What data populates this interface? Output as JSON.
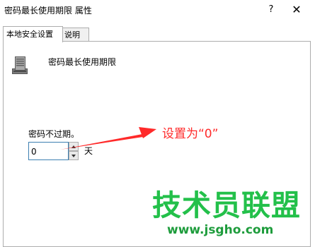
{
  "window": {
    "title": "密码最长使用期限 属性",
    "help_label": "?",
    "close_label": "✕"
  },
  "tabs": [
    {
      "label": "本地安全设置",
      "active": true
    },
    {
      "label": "说明",
      "active": false
    }
  ],
  "policy": {
    "icon": "server-icon",
    "name": "密码最长使用期限",
    "never_expire_label": "密码不过期。",
    "value": "0",
    "unit": "天"
  },
  "annotation": {
    "text": "设置为“0”",
    "color": "#ff2a2a"
  },
  "watermark": {
    "site_name": "技术员联盟",
    "url": "www.jsgho.com",
    "color": "#23c04a"
  }
}
